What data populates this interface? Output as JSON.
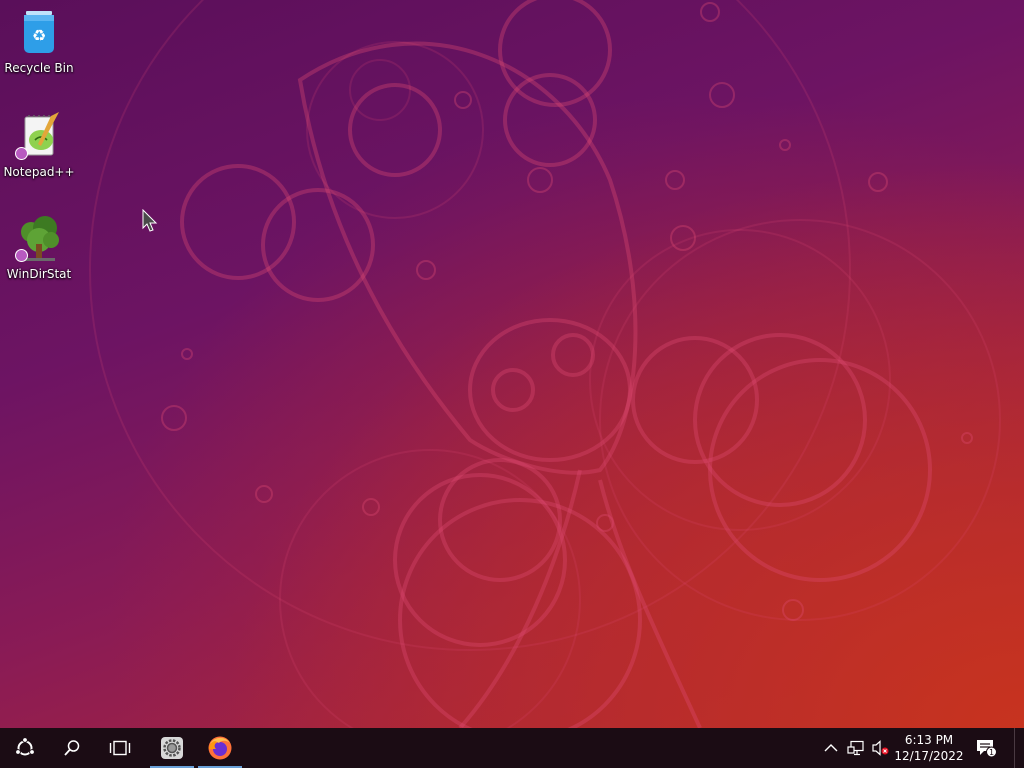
{
  "desktop": {
    "icons": [
      {
        "label": "Recycle Bin",
        "icon": "recycle-bin-icon"
      },
      {
        "label": "Notepad++",
        "icon": "notepad-plus-plus-icon"
      },
      {
        "label": "WinDirStat",
        "icon": "windirstat-icon"
      }
    ]
  },
  "taskbar": {
    "start_icon": "ubuntu-logo-icon",
    "search_icon": "search-icon",
    "taskview_icon": "task-view-icon",
    "pinned": [
      {
        "app": "settings-icon",
        "running": true
      },
      {
        "app": "firefox-icon",
        "running": true
      }
    ],
    "tray": {
      "chevron": "chevron-up-icon",
      "network": "network-icon",
      "volume": "volume-muted-icon",
      "time": "6:13 PM",
      "date": "12/17/2022",
      "notifications_count": "1"
    }
  },
  "colors": {
    "taskbar_bg": "#1b0c14",
    "accent": "#6aa0d8"
  }
}
